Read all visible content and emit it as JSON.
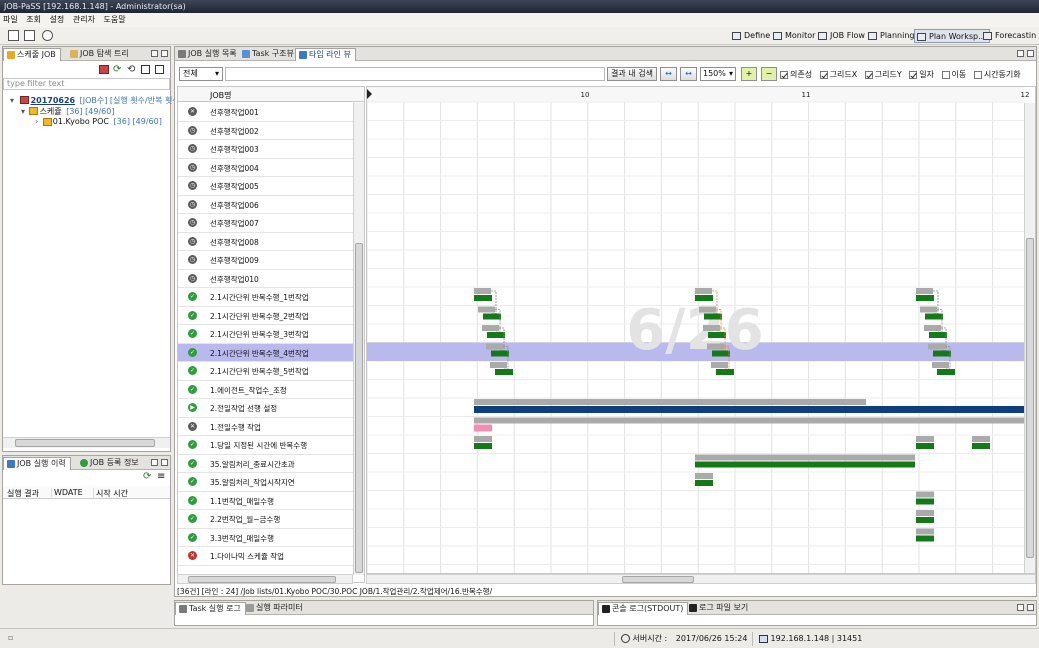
{
  "window": {
    "title": "JOB-PaSS [192.168.1.148] - Administrator(sa)"
  },
  "menu": [
    "파일",
    "조회",
    "설정",
    "관리자",
    "도움말"
  ],
  "perspectives": [
    {
      "label": "Define",
      "active": false
    },
    {
      "label": "Monitor",
      "active": false
    },
    {
      "label": "JOB Flow",
      "active": false
    },
    {
      "label": "Planning",
      "active": false
    },
    {
      "label": "Plan Worksp...",
      "active": true
    },
    {
      "label": "Forecastin",
      "active": false
    }
  ],
  "left_top": {
    "tabs": [
      "스케줄 JOB",
      "JOB 탐색 트리"
    ],
    "filter_placeholder": "type filter text",
    "tree": {
      "date": "20170626",
      "date_suffix": "[JOB수] [실행 횟수/반복 횟수]",
      "schedule": "스케쥴",
      "schedule_counts": "[36] [49/60]",
      "folder": "01.Kyobo POC",
      "folder_counts": "[36] [49/60]"
    }
  },
  "left_bottom": {
    "tabs": [
      "JOB 실행 이력",
      "JOB 등록 정보"
    ],
    "columns": [
      "실행 결과",
      "WDATE",
      "시작 시간"
    ]
  },
  "main": {
    "tabs": [
      "JOB 실행 목록",
      "Task 구조뷰",
      "타임 라인 뷰"
    ],
    "filter_value": "전체",
    "search_button": "결과 내 검색",
    "zoom": "150%",
    "checkboxes": [
      {
        "label": "의존성",
        "checked": true
      },
      {
        "label": "그리드X",
        "checked": true
      },
      {
        "label": "그리드Y",
        "checked": true
      },
      {
        "label": "일자",
        "checked": true
      },
      {
        "label": "이동",
        "checked": false
      },
      {
        "label": "시간동기화",
        "checked": false
      }
    ],
    "column_header": "JOB명",
    "hours": [
      "10",
      "11",
      "12"
    ],
    "watermark": "6/26",
    "jobs": [
      {
        "name": "선후행작업001",
        "status": "error-gray"
      },
      {
        "name": "선후행작업002",
        "status": "clock"
      },
      {
        "name": "선후행작업003",
        "status": "clock"
      },
      {
        "name": "선후행작업004",
        "status": "clock"
      },
      {
        "name": "선후행작업005",
        "status": "clock"
      },
      {
        "name": "선후행작업006",
        "status": "clock"
      },
      {
        "name": "선후행작업007",
        "status": "clock"
      },
      {
        "name": "선후행작업008",
        "status": "clock"
      },
      {
        "name": "선후행작업009",
        "status": "clock"
      },
      {
        "name": "선후행작업010",
        "status": "clock"
      },
      {
        "name": "2.1시간단위 반복수행_1번작업",
        "status": "ok"
      },
      {
        "name": "2.1시간단위 반복수행_2번작업",
        "status": "ok"
      },
      {
        "name": "2.1시간단위 반복수행_3번작업",
        "status": "ok"
      },
      {
        "name": "2.1시간단위 반복수행_4번작업",
        "status": "ok"
      },
      {
        "name": "2.1시간단위 반복수행_5번작업",
        "status": "ok"
      },
      {
        "name": "1.에이전트_작업수_조정",
        "status": "ok"
      },
      {
        "name": "2.전일작업 선행 설정",
        "status": "play"
      },
      {
        "name": "1.전일수행 작업",
        "status": "error-gray"
      },
      {
        "name": "1.당일 지정된 시간에 반복수행",
        "status": "ok"
      },
      {
        "name": "35.알림처리_종료시간초과",
        "status": "ok"
      },
      {
        "name": "35.알림처리_작업시작지연",
        "status": "ok"
      },
      {
        "name": "1.1번작업_매일수행",
        "status": "ok"
      },
      {
        "name": "2.2번작업_월~금수행",
        "status": "ok"
      },
      {
        "name": "3.3번작업_매일수행",
        "status": "ok"
      },
      {
        "name": "1.다이나믹 스케쥴 작업",
        "status": "err"
      }
    ],
    "selected_index": 13,
    "path": "[36건] [라인 : 24] /Job lists/01.Kyobo POC/30.POC JOB/1.작업관리/2.작업제어/16.반복수행/"
  },
  "bottom_tabs_left": [
    "Task 실행 로그",
    "실행 파라미터"
  ],
  "bottom_tabs_right": [
    "콘솔 로그(STDOUT)",
    "로그 파일 보기"
  ],
  "status": {
    "server_time_label": "서버시간 :",
    "server_time": "2017/06/26 15:24",
    "server_addr": "192.168.1.148 | 31451"
  },
  "colors": {
    "accent": "#1f4e8c",
    "ok": "#2e9e3c",
    "selected_row": "#b9b9ee",
    "bar_green": "#137a17",
    "bar_gray": "#aaaaaa"
  }
}
